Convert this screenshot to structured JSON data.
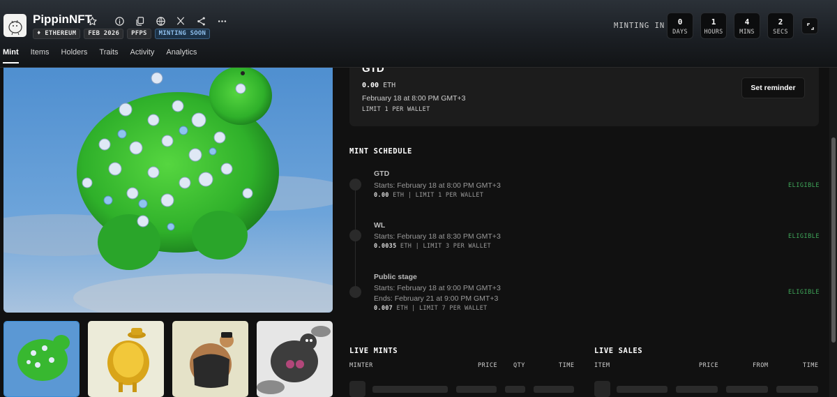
{
  "header": {
    "collection_name": "PippinNFT",
    "tags": [
      "ETHEREUM",
      "FEB 2026",
      "PFPS",
      "MINTING SOON"
    ],
    "minting_in_label": "MINTING IN",
    "countdown": [
      {
        "value": "0",
        "label": "DAYS"
      },
      {
        "value": "1",
        "label": "HOURS"
      },
      {
        "value": "4",
        "label": "MINS"
      },
      {
        "value": "2",
        "label": "SECS"
      }
    ],
    "icons": [
      "star-icon",
      "info-icon",
      "copy-icon",
      "globe-icon",
      "x-icon",
      "share-icon",
      "more-icon",
      "expand-icon"
    ]
  },
  "tabs": [
    "Mint",
    "Items",
    "Holders",
    "Traits",
    "Activity",
    "Analytics"
  ],
  "gtd_card": {
    "title": "GTD",
    "price": "0.00",
    "unit": "ETH",
    "date": "February 18 at 8:00 PM GMT+3",
    "limit": "LIMIT 1 PER WALLET",
    "reminder_button": "Set reminder"
  },
  "schedule": {
    "title": "MINT SCHEDULE",
    "stages": [
      {
        "name": "GTD",
        "starts": "Starts: February 18 at 8:00 PM GMT+3",
        "ends": "",
        "price": "0.00",
        "meta": " ETH | LIMIT 1 PER WALLET",
        "status": "ELIGIBLE"
      },
      {
        "name": "WL",
        "starts": "Starts: February 18 at 8:30 PM GMT+3",
        "ends": "",
        "price": "0.0035",
        "meta": " ETH | LIMIT 3 PER WALLET",
        "status": "ELIGIBLE"
      },
      {
        "name": "Public stage",
        "starts": "Starts: February 18 at 9:00 PM GMT+3",
        "ends": "Ends: February 21 at 9:00 PM GMT+3",
        "price": "0.007",
        "meta": " ETH | LIMIT 7 PER WALLET",
        "status": "ELIGIBLE"
      }
    ]
  },
  "live_mints": {
    "title": "LIVE MINTS",
    "columns": [
      "MINTER",
      "PRICE",
      "QTY",
      "TIME"
    ]
  },
  "live_sales": {
    "title": "LIVE SALES",
    "columns": [
      "ITEM",
      "PRICE",
      "FROM",
      "TIME"
    ]
  },
  "colors": {
    "eligible": "#3fa85a",
    "minting_soon": "#8fc0ee",
    "background": "#111111"
  }
}
